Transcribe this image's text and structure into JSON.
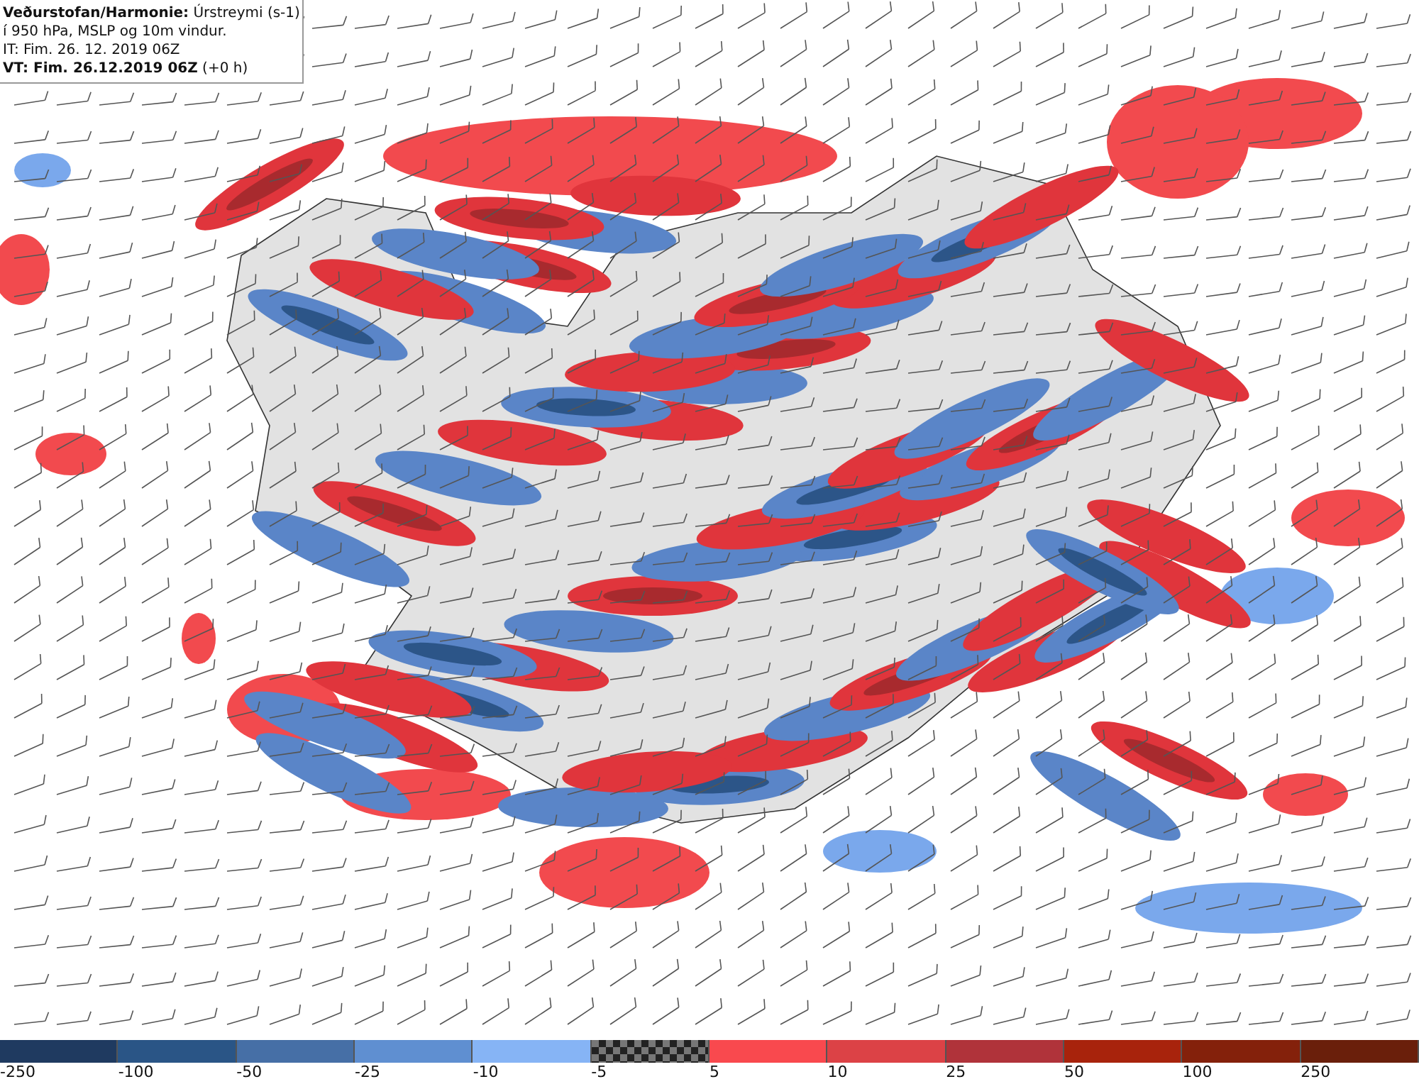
{
  "header": {
    "lines": [
      "**Veðurstofan/Harmonie:** Úrstreymi (s-1)",
      "í 950 hPa, MSLP og 10m vindur.",
      "IT: Fim. 26. 12. 2019 06Z",
      "**VT: Fim. 26.12.2019 06Z** (+0 h)"
    ]
  },
  "legend": [
    {
      "label": "-250",
      "color": "#1f3a60",
      "kind": "solid"
    },
    {
      "label": "-100",
      "color": "#2a5586",
      "kind": "solid"
    },
    {
      "label": "-50",
      "color": "#466fa6",
      "kind": "solid"
    },
    {
      "label": "-25",
      "color": "#5f8fd1",
      "kind": "solid"
    },
    {
      "label": "-10",
      "color": "#86b4f5",
      "kind": "solid"
    },
    {
      "label": "-5",
      "color": "#777777",
      "kind": "checker"
    },
    {
      "label": "5",
      "color": "#f9494e",
      "kind": "solid"
    },
    {
      "label": "10",
      "color": "#dc4246",
      "kind": "solid"
    },
    {
      "label": "25",
      "color": "#b0333a",
      "kind": "solid"
    },
    {
      "label": "50",
      "color": "#a8230c",
      "kind": "solid"
    },
    {
      "label": "100",
      "color": "#84210b",
      "kind": "solid"
    },
    {
      "label": "250",
      "color": "#6a1f0b",
      "kind": "solid"
    }
  ]
}
